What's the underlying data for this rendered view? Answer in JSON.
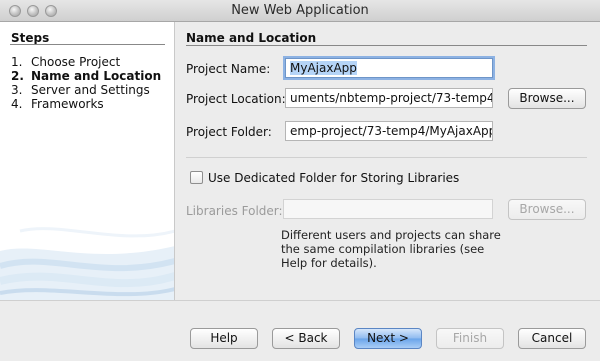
{
  "window": {
    "title": "New Web Application"
  },
  "steps": {
    "title": "Steps",
    "items": [
      {
        "num": "1.",
        "label": "Choose Project"
      },
      {
        "num": "2.",
        "label": "Name and Location"
      },
      {
        "num": "3.",
        "label": "Server and Settings"
      },
      {
        "num": "4.",
        "label": "Frameworks"
      }
    ],
    "active_index": 1
  },
  "panel": {
    "title": "Name and Location",
    "project_name": {
      "label": "Project Name:",
      "value": "MyAjaxApp"
    },
    "project_location": {
      "label": "Project Location:",
      "value": "uments/nbtemp-project/73-temp4",
      "browse_label": "Browse..."
    },
    "project_folder": {
      "label": "Project Folder:",
      "value": "emp-project/73-temp4/MyAjaxApp"
    },
    "dedicated_folder": {
      "label": "Use Dedicated Folder for Storing Libraries",
      "checked": false
    },
    "libraries_folder": {
      "label": "Libraries Folder:",
      "value": "",
      "browse_label": "Browse..."
    },
    "help_text": "Different users and projects can share the same compilation libraries (see Help for details)."
  },
  "buttons": {
    "help": "Help",
    "back": "< Back",
    "next": "Next >",
    "finish": "Finish",
    "cancel": "Cancel"
  },
  "colors": {
    "selection": "#b5d4f7",
    "focus_ring": "#8db2e3",
    "default_button": "#6aa4ea"
  }
}
